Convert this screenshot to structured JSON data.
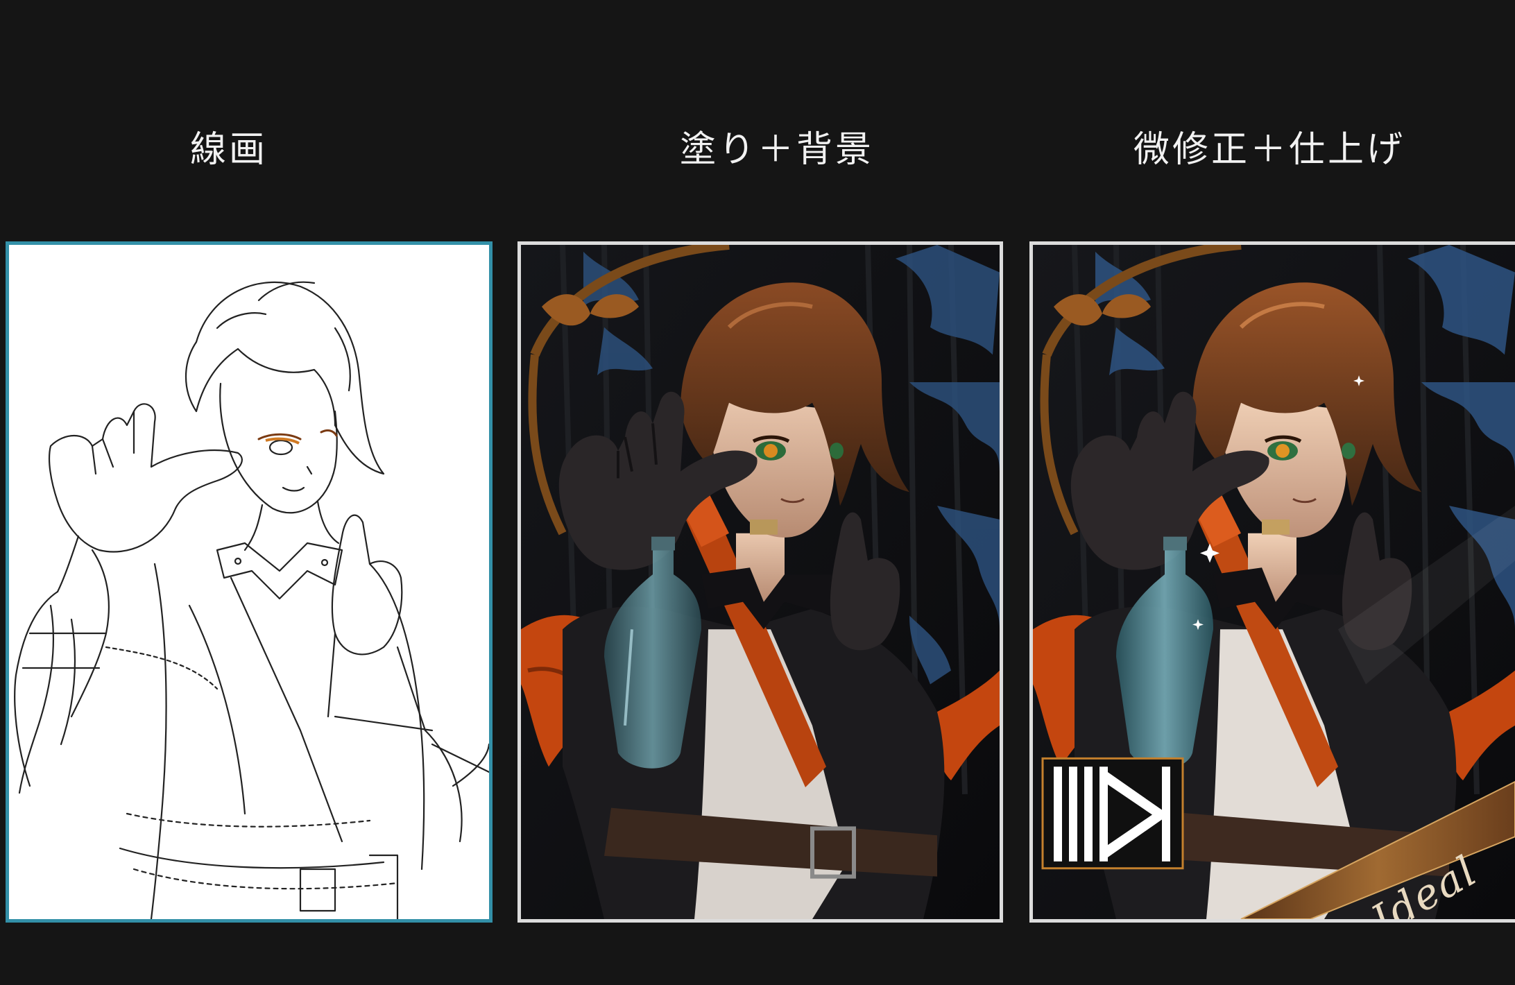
{
  "captions": {
    "line_art": "線画",
    "coloring_background": "塗り＋背景",
    "touch_up_finish": "微修正＋仕上げ"
  },
  "signature": {
    "ribbon_text": "Ideal"
  },
  "colors": {
    "page_background": "#151515",
    "caption_text": "#f2f2f2",
    "active_panel_border": "#3390a8",
    "panel_border": "#dcdcdc",
    "hair": "#6b3a1f",
    "scarf": "#c4460f",
    "bow": "#9a5a22",
    "bottle": "#5a8a94",
    "logo_border": "#c4802d"
  },
  "panels": [
    {
      "label_ref": "captions.line_art",
      "state": "selected",
      "content": "line art"
    },
    {
      "label_ref": "captions.coloring_background",
      "state": "normal",
      "content": "color + background"
    },
    {
      "label_ref": "captions.touch_up_finish",
      "state": "normal",
      "content": "final"
    }
  ]
}
